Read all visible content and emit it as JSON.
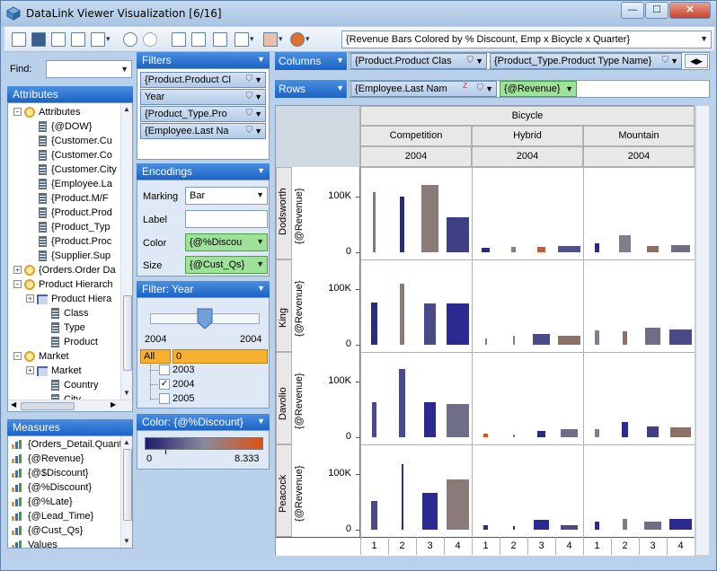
{
  "window": {
    "title": "DataLink Viewer Visualization [6/16]",
    "minimize": "—",
    "maximize": "☐",
    "close": "✕"
  },
  "toolbar": {
    "viz_selector": "{Revenue Bars Colored by % Discount, Emp x Bicycle x Quarter}"
  },
  "find": {
    "label": "Find:",
    "value": ""
  },
  "attributes": {
    "header": "Attributes",
    "items": [
      {
        "label": "Attributes",
        "kind": "folder"
      },
      {
        "label": "{@DOW}",
        "kind": "field"
      },
      {
        "label": "{Customer.Cu",
        "kind": "field"
      },
      {
        "label": "{Customer.Co",
        "kind": "field"
      },
      {
        "label": "{Customer.City",
        "kind": "field"
      },
      {
        "label": "{Employee.La",
        "kind": "field"
      },
      {
        "label": "{Product.M/F",
        "kind": "field"
      },
      {
        "label": "{Product.Prod",
        "kind": "field"
      },
      {
        "label": "{Product_Typ",
        "kind": "field"
      },
      {
        "label": "{Product.Proc",
        "kind": "field"
      },
      {
        "label": "{Supplier.Sup",
        "kind": "field"
      },
      {
        "label": "{Orders.Order Da",
        "kind": "folder"
      },
      {
        "label": "Product Hierarch",
        "kind": "folder"
      },
      {
        "label": "Product Hiera",
        "kind": "hier"
      },
      {
        "label": "Class",
        "kind": "field"
      },
      {
        "label": "Type",
        "kind": "field"
      },
      {
        "label": "Product",
        "kind": "field"
      },
      {
        "label": "Market",
        "kind": "folder"
      },
      {
        "label": "Market",
        "kind": "hier"
      },
      {
        "label": "Country",
        "kind": "field"
      },
      {
        "label": "City",
        "kind": "field"
      }
    ]
  },
  "measures": {
    "header": "Measures",
    "items": [
      "{Orders_Detail.Quant",
      "{@Revenue}",
      "{@$Discount}",
      "{@%Discount}",
      "{@%Late}",
      "{@Lead_Time}",
      "{@Cust_Qs}",
      "Values"
    ]
  },
  "filters": {
    "header": "Filters",
    "items": [
      "{Product.Product Cl",
      "Year",
      "{Product_Type.Pro",
      "{Employee.Last Na"
    ]
  },
  "encodings": {
    "header": "Encodings",
    "marking_label": "Marking",
    "marking_value": "Bar",
    "label_label": "Label",
    "label_value": "",
    "color_label": "Color",
    "color_value": "{@%Discou",
    "size_label": "Size",
    "size_value": "{@Cust_Qs}"
  },
  "filter_year": {
    "header": "Filter: Year",
    "min": "2004",
    "max": "2004",
    "all_label": "All",
    "count_value": "0",
    "years": [
      {
        "label": "2003",
        "checked": false
      },
      {
        "label": "2004",
        "checked": true
      },
      {
        "label": "2005",
        "checked": false
      }
    ]
  },
  "color_legend": {
    "header": "Color: {@%Discount}",
    "min": "0",
    "max": "8.333",
    "colors": [
      "#1c1c6e",
      "#8a8aa0",
      "#e05010"
    ]
  },
  "shelves": {
    "columns_label": "Columns",
    "columns": [
      "{Product.Product Clas",
      "{Product_Type.Product Type Name}"
    ],
    "rows_label": "Rows",
    "rows": [
      "{Employee.Last Nam",
      "{@Revenue}"
    ]
  },
  "chart_data": {
    "type": "bar",
    "top_header": "Bicycle",
    "column_headers": [
      "Competition",
      "Hybrid",
      "Mountain"
    ],
    "year_label": "2004",
    "row_headers": [
      "Dodsworth",
      "King",
      "Davolio",
      "Peacock"
    ],
    "ylabel": "{@Revenue}",
    "yticks": [
      "0",
      "100K"
    ],
    "ylim": [
      0,
      140000
    ],
    "quarters": [
      "1",
      "2",
      "3",
      "4"
    ],
    "cells": [
      [
        [
          {
            "v": 108000,
            "w": 0.1,
            "c": "#8a7770"
          },
          {
            "v": 100000,
            "w": 0.2,
            "c": "#2a2a80"
          },
          {
            "v": 120000,
            "w": 0.7,
            "c": "#8a7a78"
          },
          {
            "v": 63000,
            "w": 0.9,
            "c": "#3f3f86"
          }
        ],
        [
          {
            "v": 8000,
            "w": 0.35,
            "c": "#2a2a80"
          },
          {
            "v": 9000,
            "w": 0.2,
            "c": "#7e7e8e"
          },
          {
            "v": 9000,
            "w": 0.35,
            "c": "#c0603a"
          },
          {
            "v": 11000,
            "w": 0.9,
            "c": "#50508c"
          }
        ],
        [
          {
            "v": 16000,
            "w": 0.15,
            "c": "#2a2a80"
          },
          {
            "v": 30000,
            "w": 0.5,
            "c": "#7e7e8e"
          },
          {
            "v": 11000,
            "w": 0.5,
            "c": "#8a7060"
          },
          {
            "v": 13000,
            "w": 0.75,
            "c": "#6e6e88"
          }
        ]
      ],
      [
        [
          {
            "v": 75000,
            "w": 0.25,
            "c": "#2a2a80"
          },
          {
            "v": 110000,
            "w": 0.15,
            "c": "#8a7a78"
          },
          {
            "v": 74000,
            "w": 0.5,
            "c": "#4a4a8a"
          },
          {
            "v": 74000,
            "w": 0.9,
            "c": "#2a2a90"
          }
        ],
        [
          {
            "v": 12000,
            "w": 0.05,
            "c": "#7e7e8e"
          },
          {
            "v": 16000,
            "w": 0.05,
            "c": "#7e7e8e"
          },
          {
            "v": 20000,
            "w": 0.7,
            "c": "#4a4a8a"
          },
          {
            "v": 16000,
            "w": 0.9,
            "c": "#8a7268"
          }
        ],
        [
          {
            "v": 26000,
            "w": 0.15,
            "c": "#7e7e8e"
          },
          {
            "v": 24000,
            "w": 0.2,
            "c": "#8a7268"
          },
          {
            "v": 30000,
            "w": 0.6,
            "c": "#6e6e88"
          },
          {
            "v": 28000,
            "w": 0.9,
            "c": "#4a4a8a"
          }
        ]
      ],
      [
        [
          {
            "v": 62000,
            "w": 0.15,
            "c": "#4a4a8a"
          },
          {
            "v": 123000,
            "w": 0.25,
            "c": "#4a4a8a"
          },
          {
            "v": 63000,
            "w": 0.5,
            "c": "#2a2a90"
          },
          {
            "v": 60000,
            "w": 0.9,
            "c": "#6e6e88"
          }
        ],
        [
          {
            "v": 6000,
            "w": 0.2,
            "c": "#e05010"
          },
          {
            "v": 5000,
            "w": 0.05,
            "c": "#7e7e8e"
          },
          {
            "v": 12000,
            "w": 0.35,
            "c": "#2a2a80"
          },
          {
            "v": 14000,
            "w": 0.7,
            "c": "#6e6e88"
          }
        ],
        [
          {
            "v": 15000,
            "w": 0.2,
            "c": "#7e7e8e"
          },
          {
            "v": 28000,
            "w": 0.25,
            "c": "#2a2a90"
          },
          {
            "v": 20000,
            "w": 0.5,
            "c": "#3f3f86"
          },
          {
            "v": 18000,
            "w": 0.85,
            "c": "#8a7268"
          }
        ]
      ],
      [
        [
          {
            "v": 52000,
            "w": 0.25,
            "c": "#4a4a8a"
          },
          {
            "v": 118000,
            "w": 0.05,
            "c": "#2a2a90"
          },
          {
            "v": 66000,
            "w": 0.6,
            "c": "#2a2a90"
          },
          {
            "v": 90000,
            "w": 0.95,
            "c": "#8a7a78"
          }
        ],
        [
          {
            "v": 8000,
            "w": 0.15,
            "c": "#2a2a90"
          },
          {
            "v": 6000,
            "w": 0.05,
            "c": "#2a2a80"
          },
          {
            "v": 18000,
            "w": 0.6,
            "c": "#2a2a90"
          },
          {
            "v": 8000,
            "w": 0.7,
            "c": "#4a4a8a"
          }
        ],
        [
          {
            "v": 15000,
            "w": 0.15,
            "c": "#2a2a90"
          },
          {
            "v": 20000,
            "w": 0.2,
            "c": "#7e7e8e"
          },
          {
            "v": 14000,
            "w": 0.7,
            "c": "#6e6e88"
          },
          {
            "v": 20000,
            "w": 0.9,
            "c": "#2a2a90"
          }
        ]
      ]
    ]
  }
}
